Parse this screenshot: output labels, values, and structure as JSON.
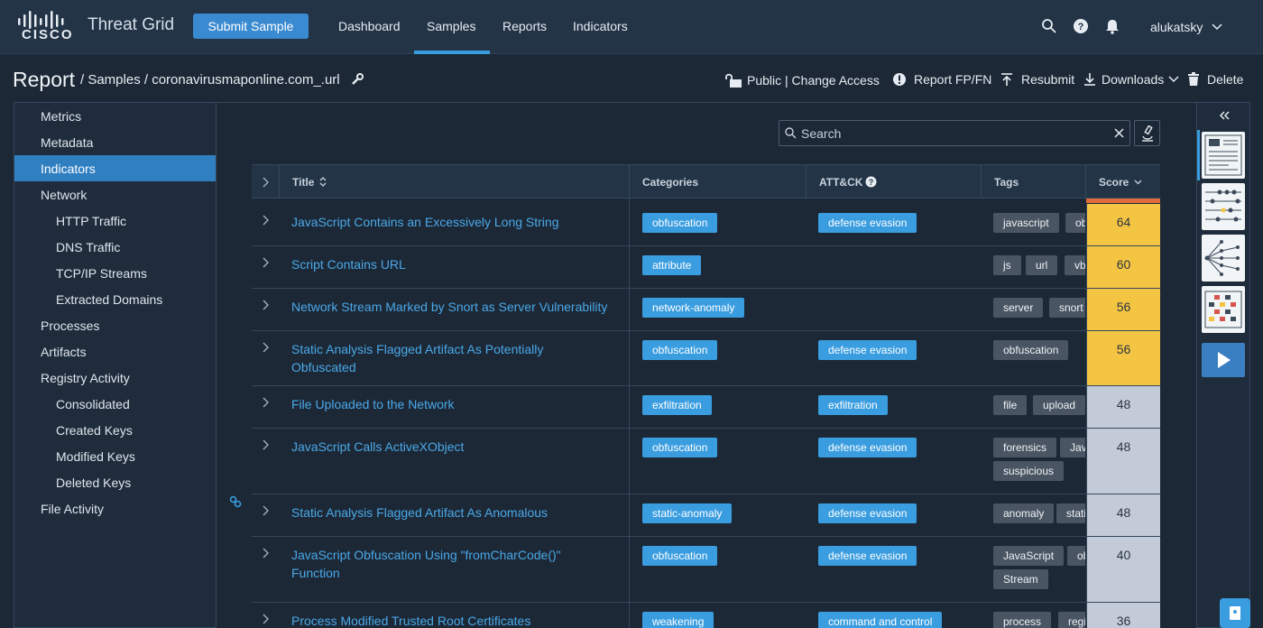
{
  "brand": {
    "logo_text": "CISCO",
    "app_title": "Threat Grid",
    "submit_label": "Submit Sample"
  },
  "nav": [
    {
      "label": "Dashboard"
    },
    {
      "label": "Samples"
    },
    {
      "label": "Reports"
    },
    {
      "label": "Indicators"
    }
  ],
  "user": {
    "name": "alukatsky"
  },
  "header": {
    "title": "Report",
    "breadcrumb": "/ Samples / coronavirusmaponline.com_.url",
    "actions": {
      "access": "Public | Change Access",
      "fpfn": "Report FP/FN",
      "resubmit": "Resubmit",
      "downloads": "Downloads",
      "delete": "Delete"
    }
  },
  "sidebar": {
    "items": [
      {
        "label": "Metrics"
      },
      {
        "label": "Metadata"
      },
      {
        "label": "Indicators"
      },
      {
        "label": "Network"
      },
      {
        "label": "HTTP Traffic"
      },
      {
        "label": "DNS Traffic"
      },
      {
        "label": "TCP/IP Streams"
      },
      {
        "label": "Extracted Domains"
      },
      {
        "label": "Processes"
      },
      {
        "label": "Artifacts"
      },
      {
        "label": "Registry Activity"
      },
      {
        "label": "Consolidated"
      },
      {
        "label": "Created Keys"
      },
      {
        "label": "Modified Keys"
      },
      {
        "label": "Deleted Keys"
      },
      {
        "label": "File Activity"
      }
    ]
  },
  "search": {
    "placeholder": "Search"
  },
  "table": {
    "headers": {
      "title": "Title",
      "categories": "Categories",
      "attck": "ATT&CK",
      "tags": "Tags",
      "score": "Score"
    },
    "rows": [
      {
        "title": "JavaScript Contains an Excessively Long String",
        "category": "obfuscation",
        "attck": "defense evasion",
        "tags": [
          "javascript",
          "obfuscation"
        ],
        "score": "64"
      },
      {
        "title": "Script Contains URL",
        "category": "attribute",
        "attck": "",
        "tags": [
          "js",
          "url",
          "vbs"
        ],
        "score": "60"
      },
      {
        "title": "Network Stream Marked by Snort as Server Vulnerability",
        "category": "network-anomaly",
        "attck": "",
        "tags": [
          "server",
          "snort"
        ],
        "score": "56"
      },
      {
        "title": "Static Analysis Flagged Artifact As Potentially Obfuscated",
        "category": "obfuscation",
        "attck": "defense evasion",
        "tags": [
          "obfuscation"
        ],
        "score": "56"
      },
      {
        "title": "File Uploaded to the Network",
        "category": "exfiltration",
        "attck": "exfiltration",
        "tags": [
          "file",
          "upload"
        ],
        "score": "48"
      },
      {
        "title": "JavaScript Calls ActiveXObject",
        "category": "obfuscation",
        "attck": "defense evasion",
        "tags": [
          "forensics",
          "JavaScript",
          "suspicious"
        ],
        "score": "48"
      },
      {
        "title": "Static Analysis Flagged Artifact As Anomalous",
        "category": "static-anomaly",
        "attck": "defense evasion",
        "tags": [
          "anomaly",
          "static"
        ],
        "score": "48"
      },
      {
        "title": "JavaScript Obfuscation Using \"fromCharCode()\" Function",
        "category": "obfuscation",
        "attck": "defense evasion",
        "tags": [
          "JavaScript",
          "obfuscation",
          "Stream"
        ],
        "score": "40"
      },
      {
        "title": "Process Modified Trusted Root Certificates",
        "category": "weakening",
        "attck": "command and control",
        "tags": [
          "process",
          "registry"
        ],
        "score": "36"
      }
    ]
  },
  "colors": {
    "accent": "#3a9de0",
    "score_high": "#f4c542",
    "score_low": "#c2cbd7"
  }
}
